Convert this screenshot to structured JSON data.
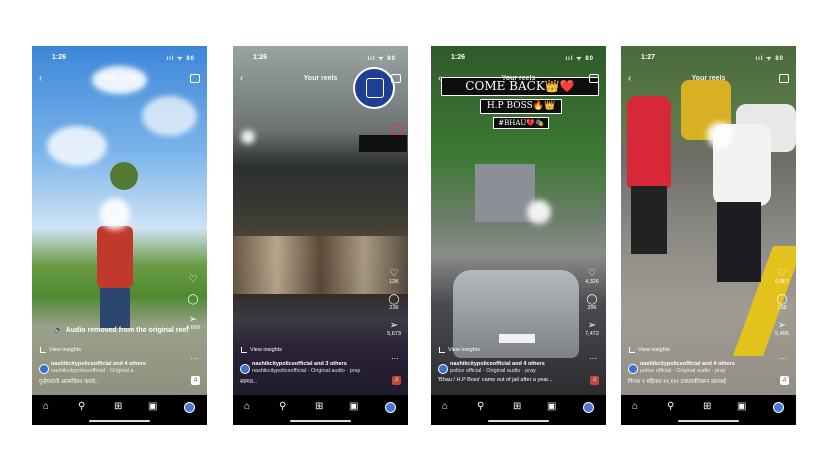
{
  "phones": [
    {
      "time": "1:26",
      "signal": "ııl ᯤ 80",
      "title": "Your reels",
      "overlay_text": "Audio removed from the original reel",
      "rail": {
        "likes": "",
        "comments": "",
        "shares": "4,669"
      },
      "view_insights": "View insights",
      "account_name": "nashikcitypoliceofficial and 4 others",
      "account_sub": "nashikcitypoliceofficial · Original a",
      "caption": "गुन्हेगारांनी आत्मचिंतन करावे...",
      "music_icon": "music-note-icon"
    },
    {
      "time": "1:26",
      "signal": "ııl ᯤ 80",
      "title": "Your reels",
      "rail": {
        "likes": "12K",
        "comments": "236",
        "shares": "5,673"
      },
      "view_insights": "View insights",
      "account_name": "nashikcitypoliceofficial and 3 others",
      "account_sub": "nashikcitypoliceofficial · Original audio · pray",
      "caption": "स्वागत..."
    },
    {
      "time": "1:26",
      "signal": "ııl ᯤ 80",
      "title": "Your reels",
      "banner": [
        "COME BACK👑❤️",
        "H.P BOSS🔥👑",
        "#BHAU💔🎭"
      ],
      "rail": {
        "likes": "4,326",
        "comments": "396",
        "shares": "7,472"
      },
      "view_insights": "View insights",
      "account_name": "nashikcitypoliceofficial and 4 others",
      "account_sub": "police official · Original audio · pray",
      "caption": "'Bhau / H.P Boss' came out of jail after a year..."
    },
    {
      "time": "1:27",
      "signal": "ııl ᯤ 80",
      "title": "Your reels",
      "rail": {
        "likes": "6,867",
        "comments": "158",
        "shares": "5,495"
      },
      "view_insights": "View insights",
      "account_name": "nashikcitypoliceofficial and 4 others",
      "account_sub": "police official · Original audio · pray",
      "caption": "गिरफा १ महिनात ११,१११ टाकडाकीवरून कारवाई"
    }
  ]
}
